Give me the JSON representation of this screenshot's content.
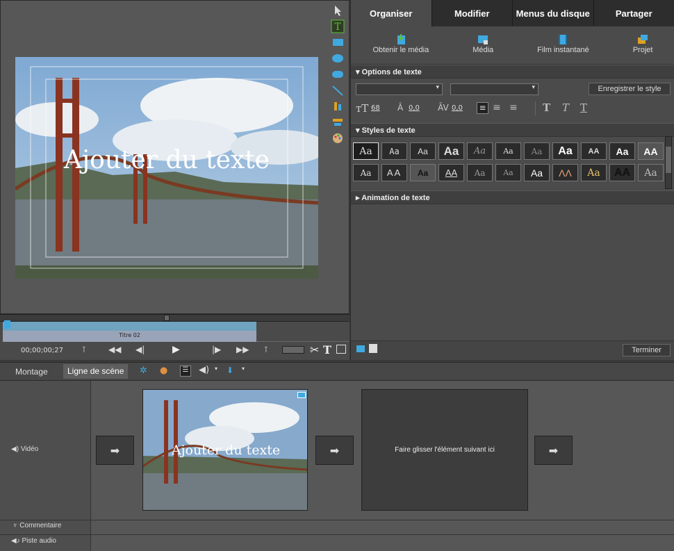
{
  "monitor": {
    "preview_text": "Ajouter du texte",
    "timecode": "00;00;00;27",
    "clip_label": "Titre 02"
  },
  "right_panel": {
    "tabs": [
      {
        "label": "Organiser",
        "active": true
      },
      {
        "label": "Modifier",
        "active": false
      },
      {
        "label": "Menus du disque",
        "active": false
      },
      {
        "label": "Partager",
        "active": false
      }
    ],
    "subtools": [
      {
        "label": "Obtenir le média",
        "icon": "get-media-icon"
      },
      {
        "label": "Média",
        "icon": "media-icon"
      },
      {
        "label": "Film instantané",
        "icon": "instant-movie-icon"
      },
      {
        "label": "Projet",
        "icon": "project-icon"
      }
    ],
    "text_options": {
      "header": "Options de texte",
      "save_style_button": "Enregistrer le style",
      "font_size": "68",
      "leading": "0,0",
      "kerning": "0,0"
    },
    "text_styles": {
      "header": "Styles de texte",
      "row1": [
        "Aa",
        "Aa",
        "Aa",
        "Aa",
        "Aa",
        "Aa",
        "Aa",
        "Aa",
        "AA",
        "Aa",
        "AA"
      ],
      "row2": [
        "Aa",
        "AA",
        "Aa",
        "AA",
        "Aa",
        "Aa",
        "Aa",
        "ΛΛ",
        "Aa",
        "AA",
        "Aa"
      ]
    },
    "text_animation": {
      "header": "Animation de texte"
    },
    "done_button": "Terminer"
  },
  "scene_bar": {
    "tabs": [
      {
        "label": "Montage",
        "active": false
      },
      {
        "label": "Ligne de scène",
        "active": true
      }
    ]
  },
  "scene": {
    "tracks": {
      "video": "Vidéo",
      "commentary": "Commentaire",
      "audio": "Piste audio"
    },
    "clip_title": "Ajouter du texte",
    "drop_target": "Faire glisser l'élément suivant ici"
  },
  "colors": {
    "accent_cyan": "#3fa9e0",
    "text_tool_green": "#5bbf3a"
  }
}
